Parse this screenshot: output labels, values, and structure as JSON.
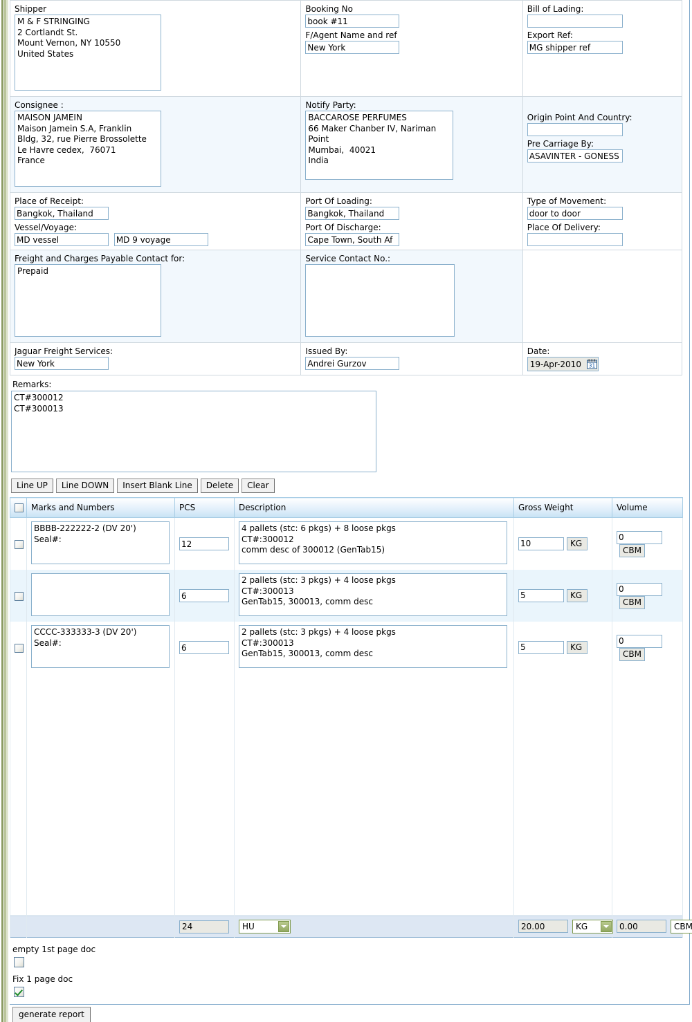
{
  "header": {
    "shipper": {
      "label": "Shipper",
      "value": "M & F STRINGING\n2 Cortlandt St.\nMount Vernon, NY 10550\nUnited States"
    },
    "booking_no": {
      "label": "Booking No",
      "value": "book #11"
    },
    "fagent": {
      "label": "F/Agent Name and ref",
      "value": "New York"
    },
    "bill_of_lading": {
      "label": "Bill of Lading:",
      "value": ""
    },
    "export_ref": {
      "label": "Export Ref:",
      "value": "MG shipper ref"
    },
    "consignee": {
      "label": "Consignee :",
      "value": "MAISON JAMEIN\nMaison Jamein S.A, Franklin\nBldg, 32, rue Pierre Brossolette\nLe Havre cedex,  76071\nFrance"
    },
    "notify_party": {
      "label": "Notify Party:",
      "value": "BACCAROSE PERFUMES\n66 Maker Chanber IV, Nariman\nPoint\nMumbai,  40021\nIndia"
    },
    "origin_point": {
      "label": "Origin Point And Country:",
      "value": ""
    },
    "pre_carriage_by": {
      "label": "Pre Carriage By:",
      "value": "ASAVINTER - GONESS"
    },
    "place_of_receipt": {
      "label": "Place of Receipt:",
      "value": "Bangkok, Thailand"
    },
    "vessel_voyage": {
      "label": "Vessel/Voyage:",
      "vessel": "MD vessel",
      "voyage": "MD 9 voyage"
    },
    "port_of_loading": {
      "label": "Port Of Loading:",
      "value": "Bangkok, Thailand"
    },
    "port_of_discharge": {
      "label": "Port Of Discharge:",
      "value": "Cape Town, South Af"
    },
    "type_of_movement": {
      "label": "Type of Movement:",
      "value": "door to door"
    },
    "place_of_delivery": {
      "label": "Place Of Delivery:",
      "value": ""
    },
    "freight_charges": {
      "label": "Freight and Charges Payable Contact for:",
      "value": "Prepaid"
    },
    "service_contact": {
      "label": "Service Contact No.:",
      "value": ""
    },
    "jaguar_freight": {
      "label": "Jaguar Freight Services:",
      "value": "New York"
    },
    "issued_by": {
      "label": "Issued By:",
      "value": "Andrei Gurzov"
    },
    "date": {
      "label": "Date:",
      "value": "19-Apr-2010",
      "icon": "calendar-icon"
    }
  },
  "remarks": {
    "label": "Remarks:",
    "value": "CT#300012\nCT#300013"
  },
  "toolbar": {
    "line_up": "Line UP",
    "line_down": "Line DOWN",
    "insert_blank_line": "Insert Blank Line",
    "delete": "Delete",
    "clear": "Clear"
  },
  "cargo_table": {
    "columns": [
      "Marks and Numbers",
      "PCS",
      "Description",
      "Gross Weight",
      "Volume"
    ],
    "rows": [
      {
        "selected": false,
        "marks": "BBBB-222222-2 (DV 20')\nSeal#:",
        "pcs": "12",
        "description": "4 pallets (stc: 6 pkgs) + 8 loose pkgs\nCT#:300012\ncomm desc of 300012 (GenTab15)",
        "gross_weight": "10",
        "gross_weight_unit": "KG",
        "volume": "0",
        "volume_unit": "CBM"
      },
      {
        "selected": false,
        "marks": "",
        "pcs": "6",
        "description": "2 pallets (stc: 3 pkgs) + 4 loose pkgs\nCT#:300013\nGenTab15, 300013, comm desc",
        "gross_weight": "5",
        "gross_weight_unit": "KG",
        "volume": "0",
        "volume_unit": "CBM"
      },
      {
        "selected": false,
        "marks": "CCCC-333333-3 (DV 20')\nSeal#:",
        "pcs": "6",
        "description": "2 pallets (stc: 3 pkgs) + 4 loose pkgs\nCT#:300013\nGenTab15, 300013, comm desc",
        "gross_weight": "5",
        "gross_weight_unit": "KG",
        "volume": "0",
        "volume_unit": "CBM"
      }
    ],
    "totals": {
      "pcs": "24",
      "pcs_unit": "HU",
      "gross_weight": "20.00",
      "gross_weight_unit": "KG",
      "volume": "0.00",
      "volume_unit": "CBM"
    }
  },
  "options": {
    "empty_first_page": {
      "label": "empty 1st page doc",
      "checked": false
    },
    "fix_one_page": {
      "label": "Fix 1 page doc",
      "checked": true
    },
    "generate_report": "generate report"
  },
  "colors": {
    "panel_border": "#7da7ca",
    "input_border": "#8ab0cc",
    "row_alt": "#eaf5fc",
    "section_blue": "#f2f8fd",
    "totals_bg": "#dde7f3",
    "select_border": "#7f9a4c",
    "check_green": "#1a8a2a",
    "edge_green": "#8b9b63"
  }
}
